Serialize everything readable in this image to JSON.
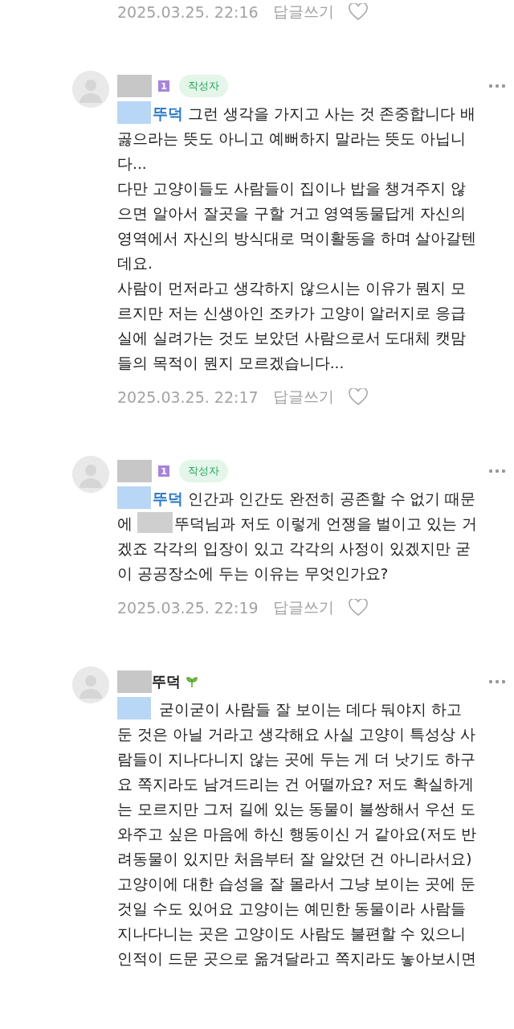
{
  "top_meta": {
    "timestamp": "2025.03.25. 22:16",
    "reply_label": "답글쓰기",
    "liked": false
  },
  "comments": [
    {
      "sprout": false,
      "level_badge": "1",
      "author_badge": "작성자",
      "mention": "뚜덕",
      "body": [
        {
          "kind": "text",
          "text": "그런 생각을 가지고 사는 것 존중합니다 배곯으라는 뜻도 아니고 예뻐하지 말라는 뜻도 아닙니다...\n다만 고양이들도 사람들이 집이나 밥을 챙겨주지 않으면 알아서 잘곳을 구할 거고 영역동물답게 자신의 영역에서 자신의 방식대로 먹이활동을 하며 살아갈텐데요.\n사람이 먼저라고 생각하지 않으시는 이유가 뭔지 모르지만 저는 신생아인 조카가 고양이 알러지로 응급실에 실려가는 것도 보았던 사람으로서 도대체 캣맘들의 목적이 뭔지 모르겠습니다..."
        }
      ],
      "timestamp": "2025.03.25. 22:17",
      "reply_label": "답글쓰기",
      "liked": false
    },
    {
      "sprout": false,
      "level_badge": "1",
      "author_badge": "작성자",
      "mention": "뚜덕",
      "body": [
        {
          "kind": "text",
          "text": "인간과 인간도 완전히 공존할 수 없기 때문에 "
        },
        {
          "kind": "redaction"
        },
        {
          "kind": "text",
          "text": "뚜덕님과 저도 이렇게 언쟁을 벌이고 있는 거겠죠 각각의 입장이 있고 각각의 사정이 있겠지만 굳이 공공장소에 두는 이유는 무엇인가요?"
        }
      ],
      "timestamp": "2025.03.25. 22:19",
      "reply_label": "답글쓰기",
      "liked": false
    },
    {
      "author": "뚜덕",
      "sprout": true,
      "body": [
        {
          "kind": "text",
          "text": "굳이굳이 사람들 잘 보이는 데다 둬야지 하고 둔 것은 아닐 거라고 생각해요 사실 고양이 특성상 사람들이 지나다니지 않는 곳에 두는 게 더 낫기도 하구요 쪽지라도 남겨드리는 건 어떨까요? 저도 확실하게는 모르지만 그저 길에 있는 동물이 불쌍해서 우선 도와주고 싶은 마음에 하신 행동이신 거 같아요(저도 반려동물이 있지만 처음부터 잘 알았던 건 아니라서요) 고양이에 대한 습성을 잘 몰라서 그냥 보이는 곳에 둔 것일 수도 있어요 고양이는 예민한 동물이라 사람들 지나다니는 곳은 고양이도 사람도 불편할 수 있으니 인적이 드문 곳으로 옮겨달라고 쪽지라도 놓아보시면"
        }
      ]
    }
  ]
}
